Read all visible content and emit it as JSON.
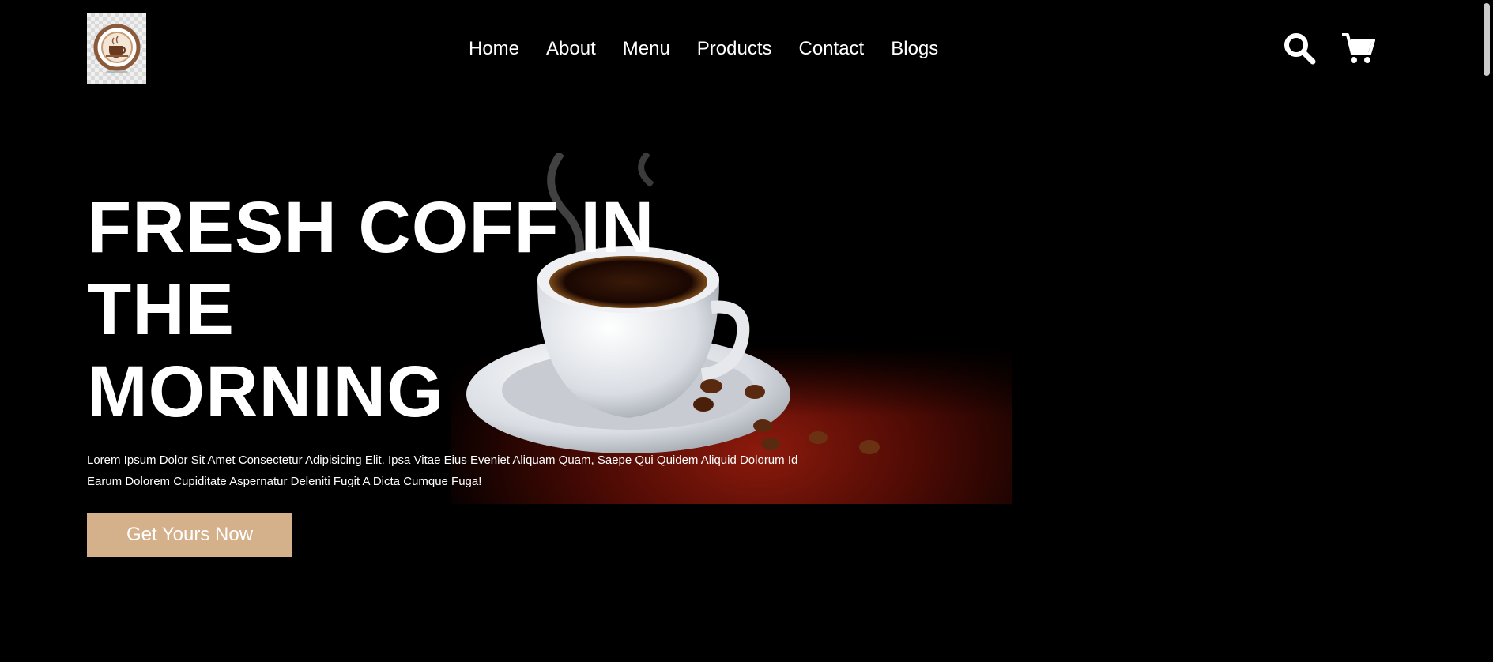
{
  "nav": {
    "items": [
      {
        "label": "Home"
      },
      {
        "label": "About"
      },
      {
        "label": "Menu"
      },
      {
        "label": "Products"
      },
      {
        "label": "Contact"
      },
      {
        "label": "Blogs"
      }
    ]
  },
  "header": {
    "icons": [
      "search-icon",
      "cart-icon"
    ]
  },
  "hero": {
    "title_line1": "FRESH COFF IN THE",
    "title_line2": "MORNING",
    "description": "Lorem Ipsum Dolor Sit Amet Consectetur Adipisicing Elit. Ipsa Vitae Eius Eveniet Aliquam Quam, Saepe Qui Quidem Aliquid Dolorum Id Earum Dolorem Cupiditate Aspernatur Deleniti Fugit A Dicta Cumque Fuga!",
    "cta_label": "Get Yours Now"
  },
  "colors": {
    "background": "#000000",
    "accent": "#d4b08b",
    "text": "#ffffff"
  }
}
